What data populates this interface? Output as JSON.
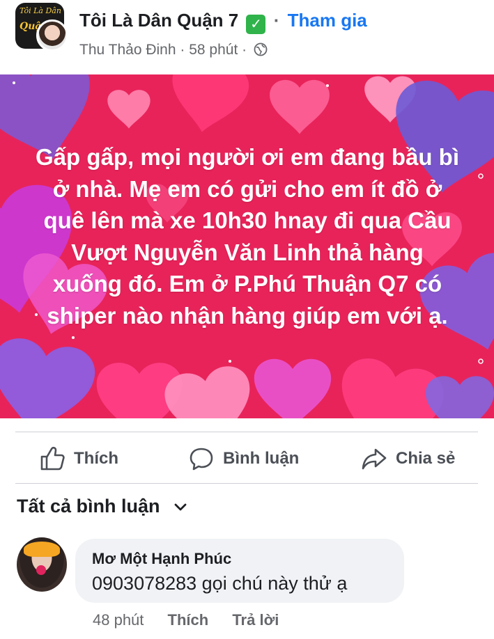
{
  "header": {
    "group_name": "Tôi Là Dân Quận 7",
    "verified_mark": "✓",
    "separator": "·",
    "join_label": "Tham gia",
    "author": "Thu Thảo Đinh",
    "time": "58 phút",
    "avatar_text_line1": "Tôi Là Dân",
    "avatar_text_line2": "Quận",
    "privacy_icon": "globe-icon"
  },
  "post": {
    "text": "Gấp gấp, mọi người ơi  em đang bầu bì ở nhà. Mẹ em có gửi cho em ít đồ ở quê lên mà xe 10h30 hnay đi qua Cầu Vượt Nguyễn Văn Linh thả hàng xuống đó. Em ở P.Phú Thuận Q7  có shiper nào nhận hàng giúp em với ạ.",
    "background_color": "#e8235a"
  },
  "actions": {
    "like_label": "Thích",
    "comment_label": "Bình luận",
    "share_label": "Chia sẻ"
  },
  "comments_section": {
    "filter_label": "Tất cả bình luận"
  },
  "comments": [
    {
      "author": "Mơ Một Hạnh Phúc",
      "text": "0903078283 gọi chú này thử ạ",
      "time": "48 phút",
      "like_label": "Thích",
      "reply_label": "Trả lời"
    }
  ],
  "colors": {
    "accent": "#1877f2",
    "verified": "#2fb34a",
    "muted_text": "#65676b",
    "comment_bubble": "#f0f2f5"
  }
}
